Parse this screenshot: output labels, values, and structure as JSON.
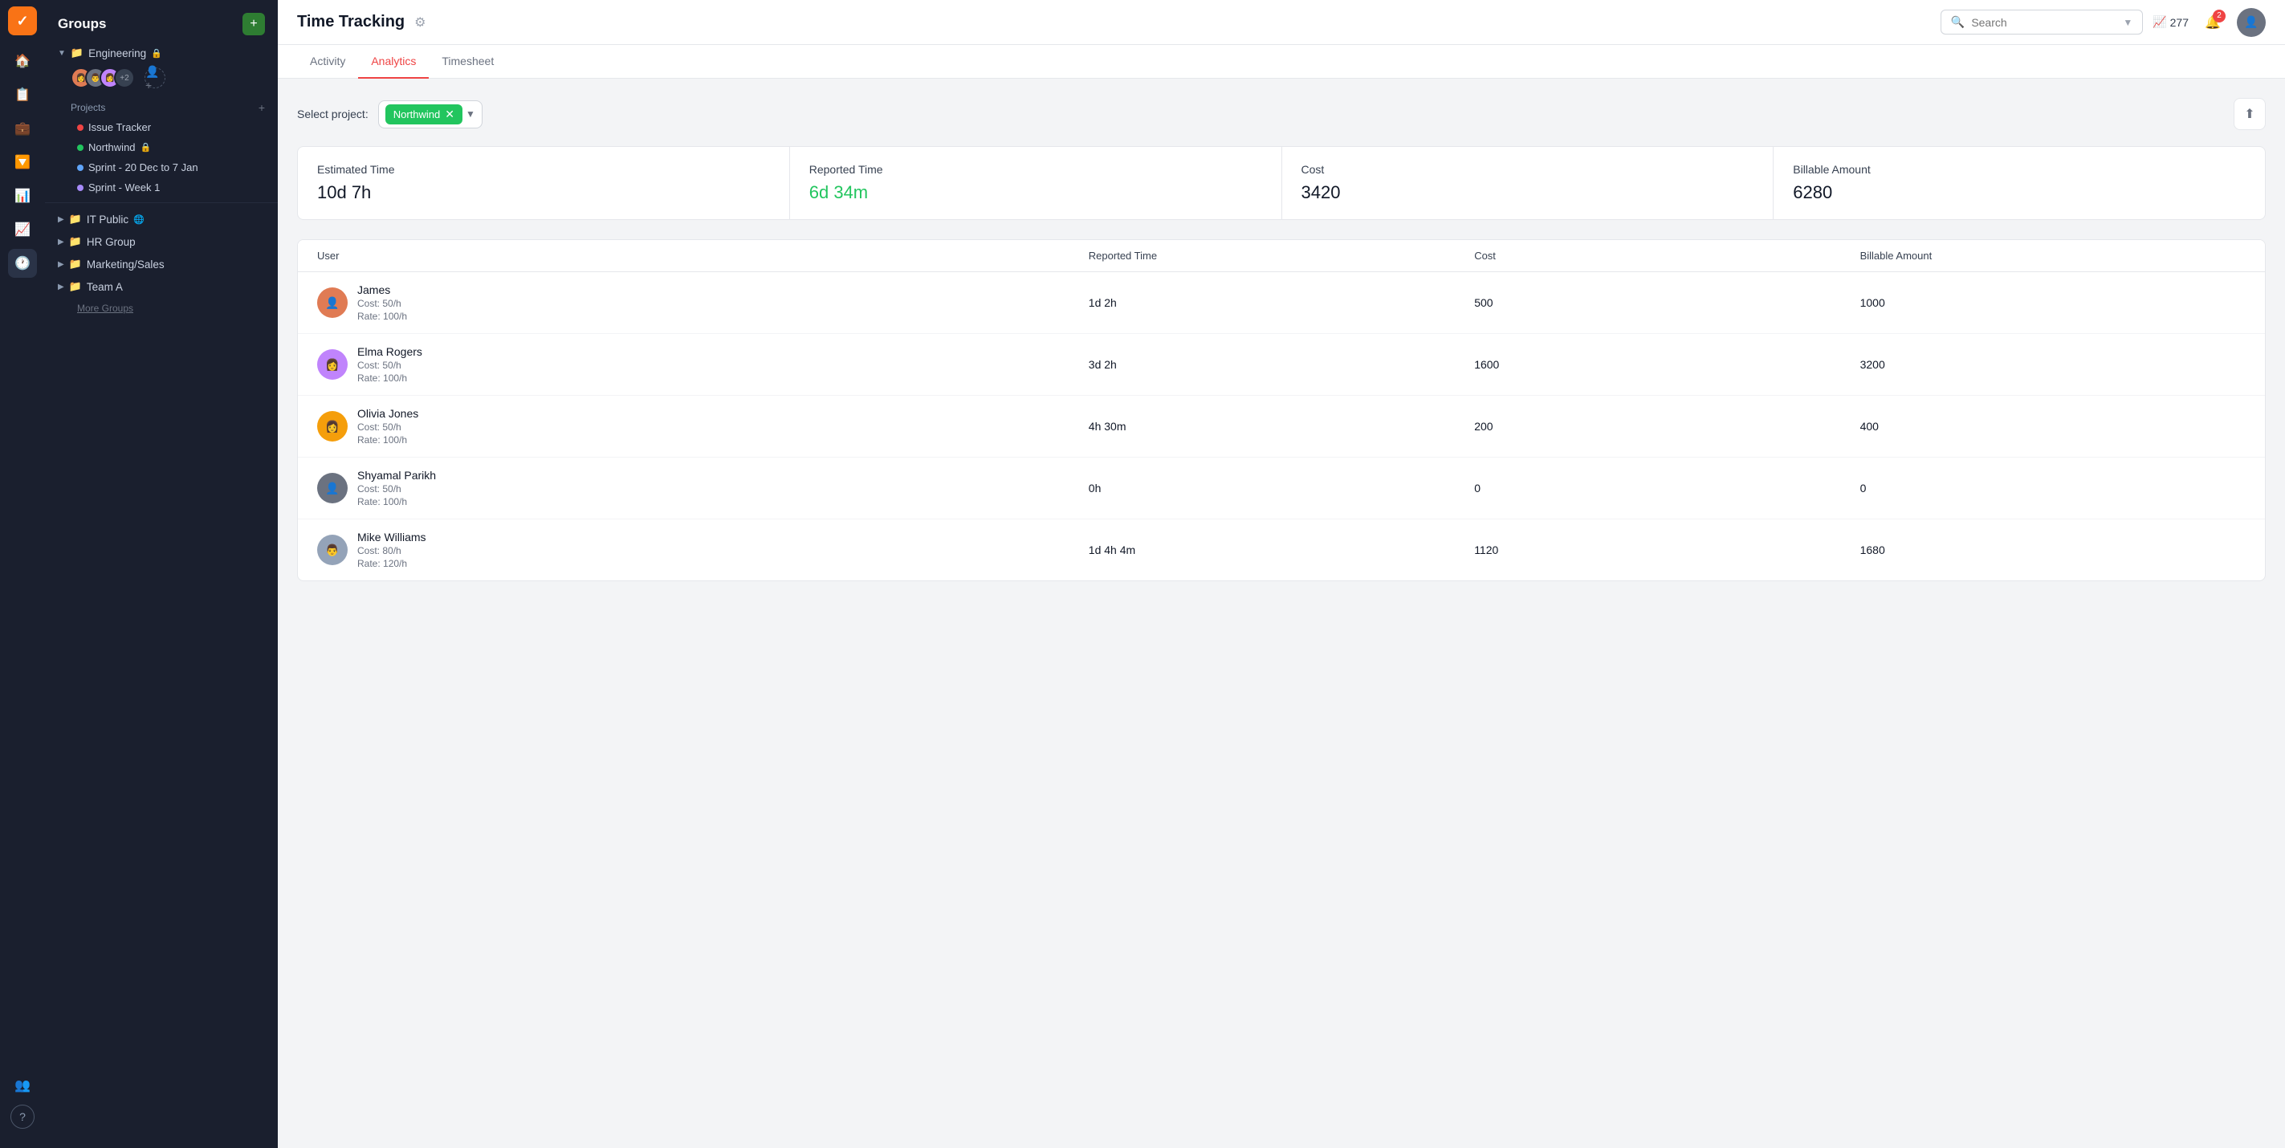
{
  "app": {
    "logo": "✓",
    "title": "Groups",
    "add_label": "+"
  },
  "sidebar": {
    "groups": [
      {
        "name": "Engineering",
        "expanded": true,
        "lock": true,
        "members_count": "+2",
        "projects_label": "Projects",
        "projects": [
          {
            "name": "Issue Tracker",
            "color": "red"
          },
          {
            "name": "Northwind",
            "color": "green",
            "lock": true
          },
          {
            "name": "Sprint - 20 Dec to 7 Jan",
            "color": "blue"
          },
          {
            "name": "Sprint - Week 1",
            "color": "purple"
          }
        ]
      },
      {
        "name": "IT Public",
        "expanded": false,
        "globe": true
      },
      {
        "name": "HR Group",
        "expanded": false
      },
      {
        "name": "Marketing/Sales",
        "expanded": false
      },
      {
        "name": "Team A",
        "expanded": false
      }
    ],
    "more_groups": "More Groups",
    "help": "?"
  },
  "header": {
    "title": "Time Tracking",
    "gear": "⚙",
    "search_placeholder": "Search",
    "trend_count": "277",
    "notif_count": "2",
    "tabs": [
      {
        "label": "Activity",
        "active": false
      },
      {
        "label": "Analytics",
        "active": true
      },
      {
        "label": "Timesheet",
        "active": false
      }
    ]
  },
  "analytics": {
    "select_project_label": "Select project:",
    "project_tag": "Northwind",
    "summary_cards": [
      {
        "label": "Estimated Time",
        "value": "10d 7h",
        "green": false
      },
      {
        "label": "Reported Time",
        "value": "6d 34m",
        "green": true
      },
      {
        "label": "Cost",
        "value": "3420",
        "green": false
      },
      {
        "label": "Billable Amount",
        "value": "6280",
        "green": false
      }
    ],
    "table": {
      "headers": [
        "User",
        "Reported Time",
        "Cost",
        "Billable Amount"
      ],
      "rows": [
        {
          "name": "James",
          "cost_rate": "Cost: 50/h",
          "rate": "Rate: 100/h",
          "reported_time": "1d 2h",
          "cost": "500",
          "billable": "1000",
          "avatar_color": "#e07b54"
        },
        {
          "name": "Elma Rogers",
          "cost_rate": "Cost: 50/h",
          "rate": "Rate: 100/h",
          "reported_time": "3d 2h",
          "cost": "1600",
          "billable": "3200",
          "avatar_color": "#c084fc"
        },
        {
          "name": "Olivia Jones",
          "cost_rate": "Cost: 50/h",
          "rate": "Rate: 100/h",
          "reported_time": "4h 30m",
          "cost": "200",
          "billable": "400",
          "avatar_color": "#f59e0b"
        },
        {
          "name": "Shyamal Parikh",
          "cost_rate": "Cost: 50/h",
          "rate": "Rate: 100/h",
          "reported_time": "0h",
          "cost": "0",
          "billable": "0",
          "avatar_color": "#6b7280"
        },
        {
          "name": "Mike Williams",
          "cost_rate": "Cost: 80/h",
          "rate": "Rate: 120/h",
          "reported_time": "1d 4h 4m",
          "cost": "1120",
          "billable": "1680",
          "avatar_color": "#94a3b8"
        }
      ]
    }
  }
}
